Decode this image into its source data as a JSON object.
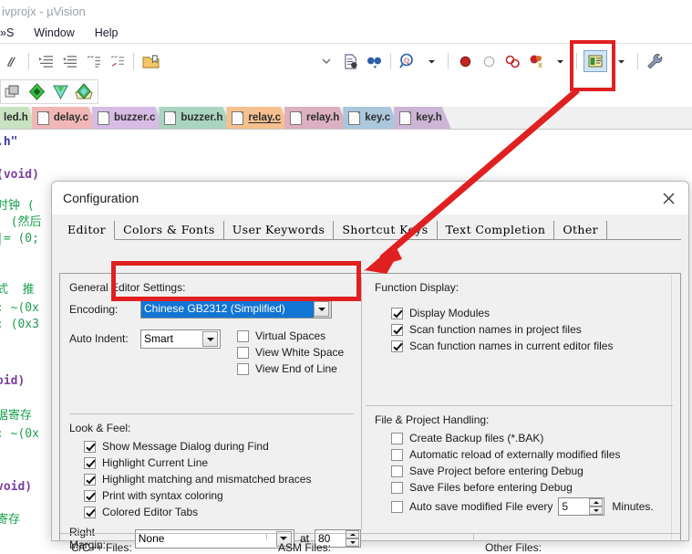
{
  "window": {
    "title": "ivprojx - µVision",
    "menu_items": [
      "»S",
      "Window",
      "Help"
    ]
  },
  "toolbar": {
    "row1_icons": [
      "format-paint-icon",
      "indent-increase-icon",
      "indent-decrease-icon",
      "comment-lines-icon",
      "uncomment-lines-icon",
      "bookmark-folder-icon"
    ],
    "row1_right_icons": [
      "chevron-down-icon",
      "file-document-icon",
      "binoculars-icon",
      "magnifier-target-icon",
      "dropdown-arrow-icon",
      "breakpoint-red-icon",
      "breakpoint-disabled-icon",
      "breakpoints-kill-icon",
      "breakpoints-disable-icon",
      "dropdown-arrow2-icon",
      "window-manage-icon",
      "dropdown-arrow3-icon",
      "wrench-configuration-icon"
    ],
    "row2_icons": [
      "target-options-icon",
      "diamond-green-icon",
      "diamond-teal-icon",
      "batch-build-icon"
    ]
  },
  "editor_tabs": [
    {
      "label": "led.h",
      "color": "#c8e2c2",
      "active": false
    },
    {
      "label": "delay.c",
      "color": "#f1b7b7",
      "active": false
    },
    {
      "label": "buzzer.c",
      "color": "#d7bde5",
      "active": false
    },
    {
      "label": "buzzer.h",
      "color": "#a9d4bf",
      "active": false
    },
    {
      "label": "relay.c",
      "color": "#f7c08f",
      "active": true
    },
    {
      "label": "relay.h",
      "color": "#dcafc1",
      "active": false
    },
    {
      "label": "key.c",
      "color": "#aac7dc",
      "active": false
    },
    {
      "label": "key.h",
      "color": "#cdb5d6",
      "active": false
    }
  ],
  "code_lines": [
    ".h\"",
    "",
    "(void)",
    "",
    "时钟 (",
    "  (然后",
    "|= (0;",
    "",
    "",
    "式  推",
    ": ~(0x",
    ": (0x3",
    "",
    "",
    "",
    "oid)",
    "",
    "据寄存",
    ": ~(0x",
    "",
    "",
    "void)",
    "",
    "寄存"
  ],
  "dialog": {
    "title": "Configuration",
    "close_icon": "close-icon",
    "tabs": [
      {
        "label": "Editor",
        "active": true
      },
      {
        "label": "Colors & Fonts",
        "active": false
      },
      {
        "label": "User Keywords",
        "active": false
      },
      {
        "label": "Shortcut Keys",
        "active": false
      },
      {
        "label": "Text Completion",
        "active": false
      },
      {
        "label": "Other",
        "active": false
      }
    ],
    "general_editor_settings": {
      "heading": "General Editor Settings:",
      "encoding_label": "Encoding:",
      "encoding_value": "Chinese GB2312 (Simplified)",
      "auto_indent_label": "Auto Indent:",
      "auto_indent_value": "Smart",
      "checkboxes": [
        {
          "label": "Virtual Spaces",
          "checked": false
        },
        {
          "label": "View White Space",
          "checked": false
        },
        {
          "label": "View End of Line",
          "checked": false
        }
      ]
    },
    "function_display": {
      "heading": "Function Display:",
      "checkboxes": [
        {
          "label": "Display Modules",
          "checked": true
        },
        {
          "label": "Scan function names in project files",
          "checked": true
        },
        {
          "label": "Scan function names in current editor files",
          "checked": true
        }
      ]
    },
    "look_and_feel": {
      "heading": "Look & Feel:",
      "checkboxes": [
        {
          "label": "Show Message Dialog during Find",
          "checked": true
        },
        {
          "label": "Highlight Current Line",
          "checked": true
        },
        {
          "label": "Highlight matching and mismatched braces",
          "checked": true
        },
        {
          "label": "Print with syntax coloring",
          "checked": true
        },
        {
          "label": "Colored Editor Tabs",
          "checked": true
        }
      ],
      "right_margin_label": "Right Margin:",
      "right_margin_value": "None",
      "at_label": "at",
      "at_value": "80"
    },
    "file_project_handling": {
      "heading": "File & Project Handling:",
      "checkboxes": [
        {
          "label": "Create Backup files (*.BAK)",
          "checked": false
        },
        {
          "label": "Automatic reload of externally modified files",
          "checked": false
        },
        {
          "label": "Save Project before entering Debug",
          "checked": false
        },
        {
          "label": "Save Files before entering Debug",
          "checked": false
        }
      ],
      "autosave_label": "Auto save modified File every",
      "autosave_value": "5",
      "autosave_suffix": "Minutes."
    },
    "bottom_columns": [
      {
        "label": "C/C++ Files:"
      },
      {
        "label": "ASM Files:"
      },
      {
        "label": "Other Files:"
      }
    ]
  },
  "annotations": {
    "highlight_color": "#e02020",
    "wrench_box_name": "wrench-toolbar-highlight",
    "encoding_box_name": "encoding-dropdown-highlight",
    "arrow_name": "pointer-arrow"
  }
}
